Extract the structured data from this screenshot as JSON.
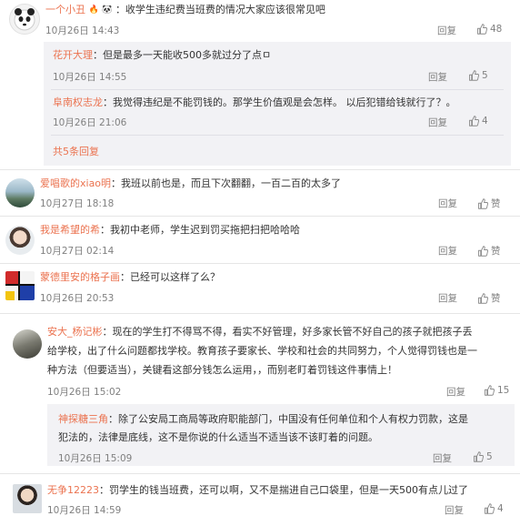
{
  "comments": [
    {
      "name": "一个小丑",
      "text": "：收学生违纪费当班费的情况大家应该很常见吧",
      "time": "10月26日 14:43",
      "reply": "回复",
      "likes": "48",
      "replies": [
        {
          "name": "花开大理",
          "text": "：但是最多一天能收500多就过分了点ㅁ",
          "time": "10月26日 14:55",
          "reply": "回复",
          "likes": "5"
        },
        {
          "name": "阜南权志龙",
          "text": "：我觉得违纪是不能罚钱的。那学生价值观是会怎样。  以后犯错给钱就行了？。",
          "time": "10月26日 21:06",
          "reply": "回复",
          "likes": "4"
        }
      ],
      "more": "共5条回复"
    },
    {
      "name": "爱唱歌的xiao明",
      "text": "：我班以前也是，而且下次翻翻，一百二百的太多了",
      "time": "10月27日 18:18",
      "reply": "回复",
      "likes": "赞"
    },
    {
      "name": "我是希望的希",
      "text": "：我初中老师，学生迟到罚买拖把扫把哈哈哈",
      "time": "10月27日 02:14",
      "reply": "回复",
      "likes": "赞"
    },
    {
      "name": "蒙德里安的格子画",
      "text": "：已经可以这样了么？",
      "time": "10月26日 20:53",
      "reply": "回复",
      "likes": "赞"
    },
    {
      "name": "安大_杨记彬",
      "text_lines": [
        "：现在的学生打不得骂不得，看实不好管理，好多家长管不好自己的孩子就把孩子丢",
        "给学校，出了什么问题都找学校。教育孩子要家长、学校和社会的共同努力，个人觉得罚钱也是一",
        "种方法（但要适当），关键看这部分钱怎么运用，，而别老盯着罚钱这件事情上！"
      ],
      "time": "10月26日 15:02",
      "reply": "回复",
      "likes": "15",
      "replies": [
        {
          "name": "神探糖三角",
          "text_lines": [
            "：除了公安局工商局等政府职能部门，中国没有任何单位和个人有权力罚款，这是",
            "犯法的，法律是底线，这不是你说的什么适当不适当该不该盯着的问题。"
          ],
          "time": "10月26日 15:09",
          "reply": "回复",
          "likes": "5"
        }
      ]
    },
    {
      "name": "无争12223",
      "text": "：罚学生的钱当班费，还可以啊，又不是揣进自己口袋里，但是一天500有点儿过了",
      "time": "10月26日 14:59",
      "reply": "回复",
      "likes": "4"
    }
  ],
  "colors": {
    "name": "#eb7350",
    "meta": "#808080",
    "subbg": "#f2f2f5"
  },
  "icons": {
    "badge1": "fire-emoji-icon",
    "badge2": "panda-emoji-icon",
    "thumb": "thumb-up-icon"
  }
}
